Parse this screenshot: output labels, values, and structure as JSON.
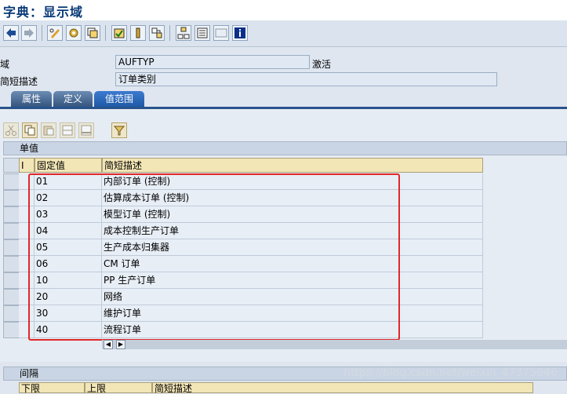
{
  "title": "字典：显示域",
  "fields": {
    "domain_label": "域",
    "domain_value": "AUFTYP",
    "domain_status": "激活",
    "short_desc_label": "简短描述",
    "short_desc_value": "订单类别"
  },
  "tabs": [
    {
      "label": "属性"
    },
    {
      "label": "定义"
    },
    {
      "label": "值范围"
    }
  ],
  "single_values": {
    "group_title": "单值",
    "columns": {
      "sel": "I",
      "fixed": "固定值",
      "desc": "简短描述"
    },
    "rows": [
      {
        "value": "01",
        "desc": "内部订单 (控制)"
      },
      {
        "value": "02",
        "desc": "估算成本订单 (控制)"
      },
      {
        "value": "03",
        "desc": "模型订单 (控制)"
      },
      {
        "value": "04",
        "desc": "成本控制生产订单"
      },
      {
        "value": "05",
        "desc": "生产成本归集器"
      },
      {
        "value": "06",
        "desc": "CM 订单"
      },
      {
        "value": "10",
        "desc": "PP 生产订单"
      },
      {
        "value": "20",
        "desc": "网络"
      },
      {
        "value": "30",
        "desc": "维护订单"
      },
      {
        "value": "40",
        "desc": "流程订单"
      }
    ]
  },
  "intervals": {
    "group_title": "间隔",
    "columns": {
      "low": "下限",
      "high": "上限",
      "desc": "简短描述"
    }
  },
  "watermark": "https://blog.csdn.net/weixin_47375646",
  "colors": {
    "highlight": "#e02828",
    "tab_active": "#1f59a6",
    "header": "#f3e6b6"
  }
}
